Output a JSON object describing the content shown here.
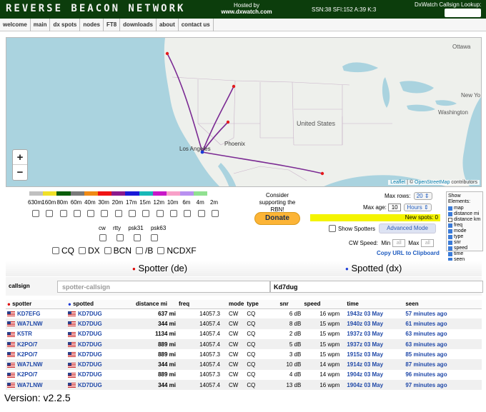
{
  "header": {
    "logo": "REVERSE BEACON NETWORK",
    "hosted_by": "Hosted by",
    "hosted_site": "www.dxwatch.com",
    "solar": "SSN:38 SFI:152 A:39 K:3",
    "lookup_label": "DxWatch Callsign Lookup:"
  },
  "nav": [
    "welcome",
    "main",
    "dx spots",
    "nodes",
    "FT8",
    "downloads",
    "about",
    "contact us"
  ],
  "map": {
    "labels": {
      "ottawa": "Ottawa",
      "new_york": "New Yo",
      "washington": "Washington",
      "united_states": "United States",
      "phoenix": "Phoenix",
      "los_angeles": "Los Angeles"
    },
    "zoom_in": "+",
    "zoom_out": "−",
    "attribution_leaflet": "Leaflet",
    "attribution_sep": " | © ",
    "attribution_osm": "OpenStreetMap",
    "attribution_tail": " contributors"
  },
  "bands": {
    "colors": [
      "#c0c0c0",
      "#f0e028",
      "#0b5e0b",
      "#7a7a7a",
      "#f08a14",
      "#f01414",
      "#8c1a8c",
      "#1a1ad8",
      "#18b8b8",
      "#c818c8",
      "#f8a0c8",
      "#b890f0",
      "#90e090"
    ],
    "labels": [
      "630m",
      "160m",
      "80m",
      "60m",
      "40m",
      "30m",
      "20m",
      "17m",
      "15m",
      "12m",
      "10m",
      "6m",
      "4m",
      "2m"
    ]
  },
  "modes": [
    "cw",
    "rtty",
    "psk31",
    "psk63"
  ],
  "dx_filters": [
    "CQ",
    "DX",
    "BCN",
    "/B",
    "NCDXF"
  ],
  "donate": {
    "text": "Consider supporting the RBN!",
    "button": "Donate"
  },
  "controls": {
    "max_rows_label": "Max rows:",
    "max_rows_value": "20",
    "max_age_label": "Max age:",
    "max_age_value": "10",
    "max_age_unit": "Hours",
    "new_spots": "New spots: 0",
    "show_spotters": "Show Spotters",
    "advanced_mode": "Advanced Mode",
    "cw_speed_label": "CW Speed:",
    "min_label": "Min",
    "max_label": "Max",
    "all_placeholder": "all",
    "copy_url": "Copy URL to Clipboard"
  },
  "show_elements": {
    "title": "Show Elements:",
    "items": [
      "map",
      "distance mi",
      "distance km",
      "freq",
      "mode",
      "type",
      "snr",
      "speed",
      "time",
      "seen"
    ],
    "checked": [
      true,
      true,
      false,
      true,
      true,
      true,
      true,
      true,
      true,
      true
    ]
  },
  "search": {
    "spotter_title": "Spotter (de)",
    "spotted_title": "Spotted (dx)",
    "callsign_label": "callsign",
    "spotter_placeholder": "spotter-callsign",
    "spotted_value": "Kd7dug"
  },
  "table": {
    "headers": [
      "spotter",
      "spotted",
      "distance mi",
      "freq",
      "mode",
      "type",
      "snr",
      "speed",
      "time",
      "seen"
    ],
    "rows": [
      [
        "KD7EFG",
        "KD7DUG",
        "637 mi",
        "14057.3",
        "CW",
        "CQ",
        "6 dB",
        "16 wpm",
        "1943z 03 May",
        "57 minutes ago"
      ],
      [
        "WA7LNW",
        "KD7DUG",
        "344 mi",
        "14057.4",
        "CW",
        "CQ",
        "8 dB",
        "15 wpm",
        "1940z 03 May",
        "61 minutes ago"
      ],
      [
        "K5TR",
        "KD7DUG",
        "1134 mi",
        "14057.4",
        "CW",
        "CQ",
        "2 dB",
        "15 wpm",
        "1937z 03 May",
        "63 minutes ago"
      ],
      [
        "K2PO/7",
        "KD7DUG",
        "889 mi",
        "14057.4",
        "CW",
        "CQ",
        "5 dB",
        "15 wpm",
        "1937z 03 May",
        "63 minutes ago"
      ],
      [
        "K2PO/7",
        "KD7DUG",
        "889 mi",
        "14057.3",
        "CW",
        "CQ",
        "3 dB",
        "15 wpm",
        "1915z 03 May",
        "85 minutes ago"
      ],
      [
        "WA7LNW",
        "KD7DUG",
        "344 mi",
        "14057.4",
        "CW",
        "CQ",
        "10 dB",
        "14 wpm",
        "1914z 03 May",
        "87 minutes ago"
      ],
      [
        "K2PO/7",
        "KD7DUG",
        "889 mi",
        "14057.3",
        "CW",
        "CQ",
        "4 dB",
        "14 wpm",
        "1904z 03 May",
        "96 minutes ago"
      ],
      [
        "WA7LNW",
        "KD7DUG",
        "344 mi",
        "14057.4",
        "CW",
        "CQ",
        "13 dB",
        "16 wpm",
        "1904z 03 May",
        "97 minutes ago"
      ]
    ]
  },
  "version": "Version: v2.2.5"
}
